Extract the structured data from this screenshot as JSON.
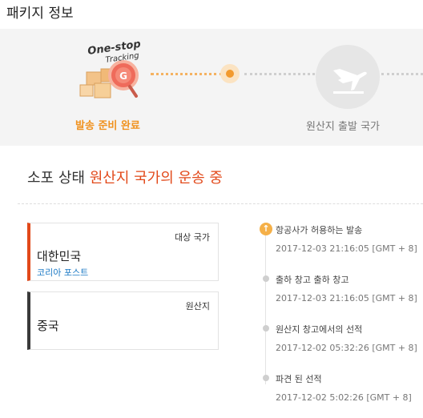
{
  "page": {
    "title": "패키지 정보"
  },
  "progress": {
    "logo_line1": "One-stop",
    "logo_line2": "Tracking",
    "logo_badge": "G",
    "step_done_label": "발송 준비 완료",
    "step_next_label": "원산지 출발 국가",
    "plane_icon": "plane-icon",
    "accent_color": "#f0921f"
  },
  "status": {
    "prefix": "소포 상태",
    "highlight": "원산지 국가의 운송 중",
    "highlight_color": "#e2491a"
  },
  "destination": {
    "tag": "대상 국가",
    "country": "대한민국",
    "carrier": "코리아 포스트"
  },
  "origin": {
    "tag": "원산지",
    "country": "중국"
  },
  "timeline": [
    {
      "title": "항공사가 허용하는 발송",
      "time": "2017-12-03 21:16:05 [GMT + 8]",
      "active": true
    },
    {
      "title": "출하 창고 출하 창고",
      "time": "2017-12-03 21:16:05 [GMT + 8]",
      "active": false
    },
    {
      "title": "원산지 창고에서의 선적",
      "time": "2017-12-02 05:32:26 [GMT + 8]",
      "active": false
    },
    {
      "title": "파견 된 선적",
      "time": "2017-12-02 5:02:26 [GMT + 8]",
      "active": false
    }
  ]
}
